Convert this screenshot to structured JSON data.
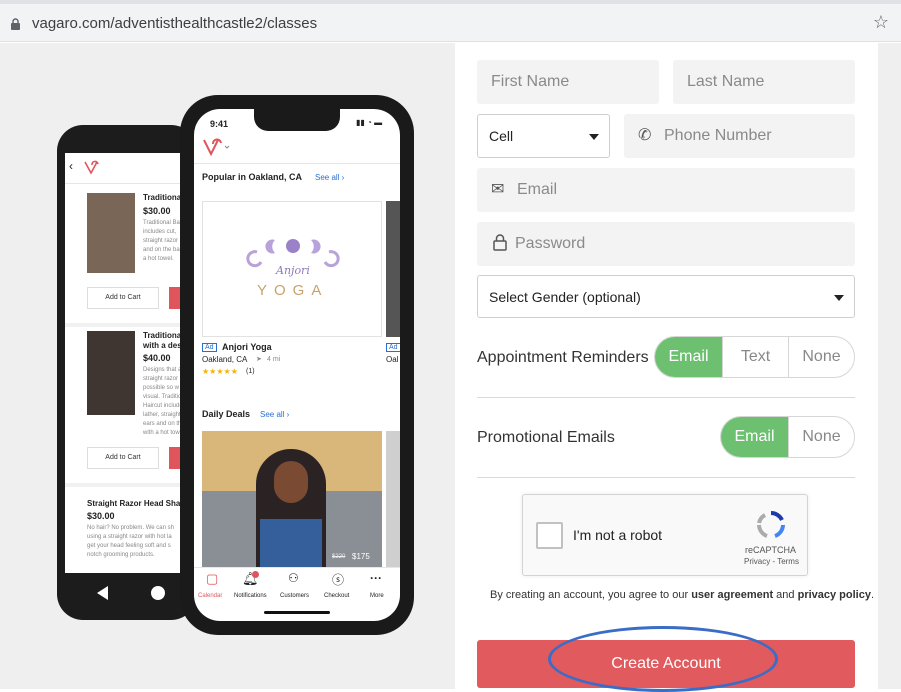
{
  "browser": {
    "url": "vagaro.com/adventisthealthcastle2/classes"
  },
  "phone_front": {
    "time": "9:41",
    "popular_title": "Popular in Oakland, CA",
    "see_all": "See all ›",
    "ad_badge": "Ad",
    "ad_badge2": "Ad",
    "biz_name": "Anjori Yoga",
    "biz_location": "Oakland, CA",
    "biz_distance": "4 mi",
    "biz_loc_partial": "Oal",
    "rating_stars": "★★★★★",
    "rating_count": "(1)",
    "logo_script": "Anjori",
    "logo_word": "YOGA",
    "daily_deals": "Daily Deals",
    "daily_see_all": "See all ›",
    "deal_old_price": "$220",
    "deal_price": "$175",
    "tabs": [
      "Calendar",
      "Notifications",
      "Customers",
      "Checkout",
      "More"
    ]
  },
  "phone_back": {
    "item1_title": "Traditional B",
    "item1_price": "$30.00",
    "item1_desc": [
      "Traditional Ba",
      "includes cut,",
      "straight razor",
      "and on the ba",
      "a hot towel."
    ],
    "item2_title": [
      "Traditional B",
      "with a desig"
    ],
    "item2_price": "$40.00",
    "item2_desc": [
      "Designs that a",
      "straight razor",
      "possible so w",
      "visual. Traditio",
      "Haircut include",
      "lather, straight",
      "ears and on th",
      "with a hot tow"
    ],
    "add_to_cart": "Add to Cart",
    "item3_title": "Straight Razor Head Shave",
    "item3_price": "$30.00",
    "item3_desc": [
      "No hair? No problem. We can sh",
      "using a straight razor with hot la",
      "get your head feeling soft and s",
      "notch grooming products."
    ]
  },
  "form": {
    "first_name_placeholder": "First Name",
    "last_name_placeholder": "Last Name",
    "phone_type": "Cell",
    "phone_placeholder": "Phone Number",
    "email_placeholder": "Email",
    "password_placeholder": "Password",
    "gender_select": "Select Gender (optional)",
    "appointment_label": "Appointment Reminders",
    "appointment_options": [
      "Email",
      "Text",
      "None"
    ],
    "appointment_selected": "Email",
    "promo_label": "Promotional Emails",
    "promo_options": [
      "Email",
      "None"
    ],
    "promo_selected": "Email",
    "captcha_label": "I'm not a robot",
    "captcha_brand": "reCAPTCHA",
    "captcha_links": "Privacy - Terms",
    "terms_prefix": "By creating an account, you agree to our ",
    "terms_link1": "user agreement",
    "terms_mid": " and ",
    "terms_link2": "privacy policy",
    "terms_suffix": ".",
    "create_button": "Create Account"
  },
  "colors": {
    "accent_green": "#6cc070",
    "create_red": "#e05a5e",
    "annotation_blue": "#3b6cc6",
    "vagaro_red": "#e0555c"
  }
}
